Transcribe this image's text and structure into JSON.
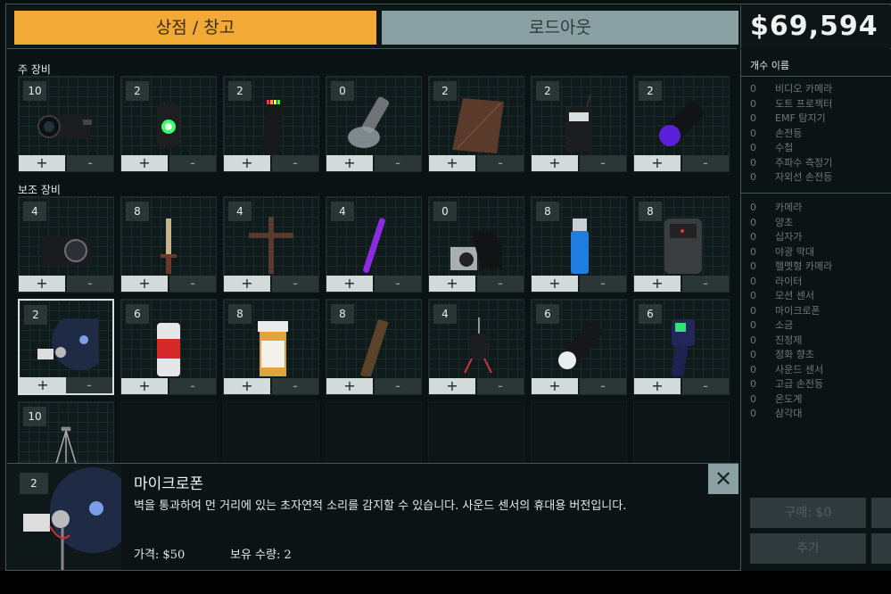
{
  "tabs": {
    "shop": "상점 / 창고",
    "loadout": "로드아웃"
  },
  "money": "$69,594",
  "sections": {
    "main": "주 장비",
    "sub": "보조 장비"
  },
  "main_items": [
    {
      "count": "10",
      "icon": "video-camera-icon"
    },
    {
      "count": "2",
      "icon": "dots-projector-icon"
    },
    {
      "count": "2",
      "icon": "emf-reader-icon"
    },
    {
      "count": "0",
      "icon": "flashlight-icon"
    },
    {
      "count": "2",
      "icon": "journal-icon"
    },
    {
      "count": "2",
      "icon": "spirit-box-icon"
    },
    {
      "count": "2",
      "icon": "uv-flashlight-icon"
    }
  ],
  "sub_items": [
    {
      "count": "4",
      "icon": "camera-icon"
    },
    {
      "count": "8",
      "icon": "candle-icon"
    },
    {
      "count": "4",
      "icon": "crucifix-icon"
    },
    {
      "count": "4",
      "icon": "glowstick-icon"
    },
    {
      "count": "0",
      "icon": "head-camera-icon"
    },
    {
      "count": "8",
      "icon": "lighter-icon"
    },
    {
      "count": "8",
      "icon": "motion-sensor-icon"
    },
    {
      "count": "2",
      "icon": "parabolic-microphone-icon"
    },
    {
      "count": "6",
      "icon": "salt-icon"
    },
    {
      "count": "8",
      "icon": "sanity-pills-icon"
    },
    {
      "count": "8",
      "icon": "smudge-sticks-icon"
    },
    {
      "count": "4",
      "icon": "sound-sensor-icon"
    },
    {
      "count": "6",
      "icon": "strong-flashlight-icon"
    },
    {
      "count": "6",
      "icon": "thermometer-icon"
    },
    {
      "count": "10",
      "icon": "tripod-icon"
    }
  ],
  "plus": "+",
  "minus": "-",
  "sidebar": {
    "header": "개수 이름",
    "group1": [
      {
        "n": "0",
        "name": "비디오 카메라"
      },
      {
        "n": "0",
        "name": "도트 프로젝터"
      },
      {
        "n": "0",
        "name": "EMF 탐지기"
      },
      {
        "n": "0",
        "name": "손전등"
      },
      {
        "n": "0",
        "name": "수첩"
      },
      {
        "n": "0",
        "name": "주파수 측정기"
      },
      {
        "n": "0",
        "name": "자외선 손전등"
      }
    ],
    "group2": [
      {
        "n": "0",
        "name": "카메라"
      },
      {
        "n": "0",
        "name": "양초"
      },
      {
        "n": "0",
        "name": "십자가"
      },
      {
        "n": "0",
        "name": "야광 막대"
      },
      {
        "n": "0",
        "name": "헬멧형 카메라"
      },
      {
        "n": "0",
        "name": "라이터"
      },
      {
        "n": "0",
        "name": "모션 센서"
      },
      {
        "n": "0",
        "name": "마이크로폰"
      },
      {
        "n": "0",
        "name": "소금"
      },
      {
        "n": "0",
        "name": "진정제"
      },
      {
        "n": "0",
        "name": "정화 향초"
      },
      {
        "n": "0",
        "name": "사운드 센서"
      },
      {
        "n": "0",
        "name": "고급 손전등"
      },
      {
        "n": "0",
        "name": "온도계"
      },
      {
        "n": "0",
        "name": "삼각대"
      }
    ],
    "buy": "구매: $0",
    "add": "추가"
  },
  "detail": {
    "count": "2",
    "title": "마이크로폰",
    "description": "벽을 통과하여 먼 거리에 있는 초자연적 소리를 감지할 수 있습니다. 사운드 센서의 휴대용 버전입니다.",
    "price": "가격: $50",
    "owned": "보유 수량: 2",
    "close": "✕"
  }
}
